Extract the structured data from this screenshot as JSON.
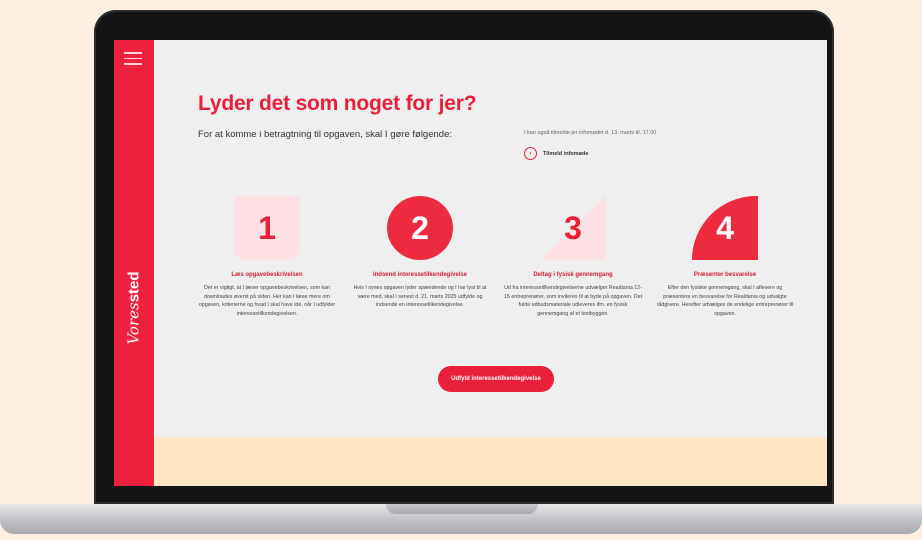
{
  "sidebar": {
    "menu_icon": "hamburger-menu-icon",
    "brand_part1": "Vores",
    "brand_part2": "sted"
  },
  "main": {
    "headline": "Lyder det som noget for jer?",
    "intro": "For at komme i betragtning til opgaven, skal I gøre følgende:",
    "side_note": "I kan også tilmelde jer infomødet d. 13. marts kl. 17.00",
    "info_link": "Tilmeld infomøde",
    "info_link_icon": "arrow-circle-icon",
    "steps": [
      {
        "number": "1",
        "title": "Læs opgavebeskrivelsen",
        "text": "Det er vigtigt, at I læser opgavebeskrivelsen, som kan downloades øverst på siden. Her kan I læse mere om opgaven, kriterierne og hvad I skal have idé, når I udfylder interessetilkendegivelsen."
      },
      {
        "number": "2",
        "title": "Indsend interessetilkendegivelse",
        "text": "Hvis I synes opgaven lyder spændende og I har lyst til at være med, skal I senest d. 21. marts 2025 udfylde og indsende en interessetilkendegivelse."
      },
      {
        "number": "3",
        "title": "Deltag i fysisk gennemgang",
        "text": "Ud fra interessetilkendegivelserne udvælger Realdania 12-15 entreprenører, som inviteres til at byde på opgaven. Det fulde udbudsmateriale udleveres ifm. en fysisk gennemgang af et testbyggeri."
      },
      {
        "number": "4",
        "title": "Præsenter besvarelse",
        "text": "Efter den fysiske gennemgang, skal I aflevere og præsentere en besvarelse for Realdania og udvalgte rådgivere. Herefter udvælges de endelige entreprenører til opgaven."
      }
    ],
    "cta_label": "Udfyld interessetilkendegivelse"
  },
  "colors": {
    "brand_red": "#f0213c",
    "light_pink": "#fde0e3",
    "cream_band": "#fde6c3",
    "page_background": "#fdf0e2"
  }
}
